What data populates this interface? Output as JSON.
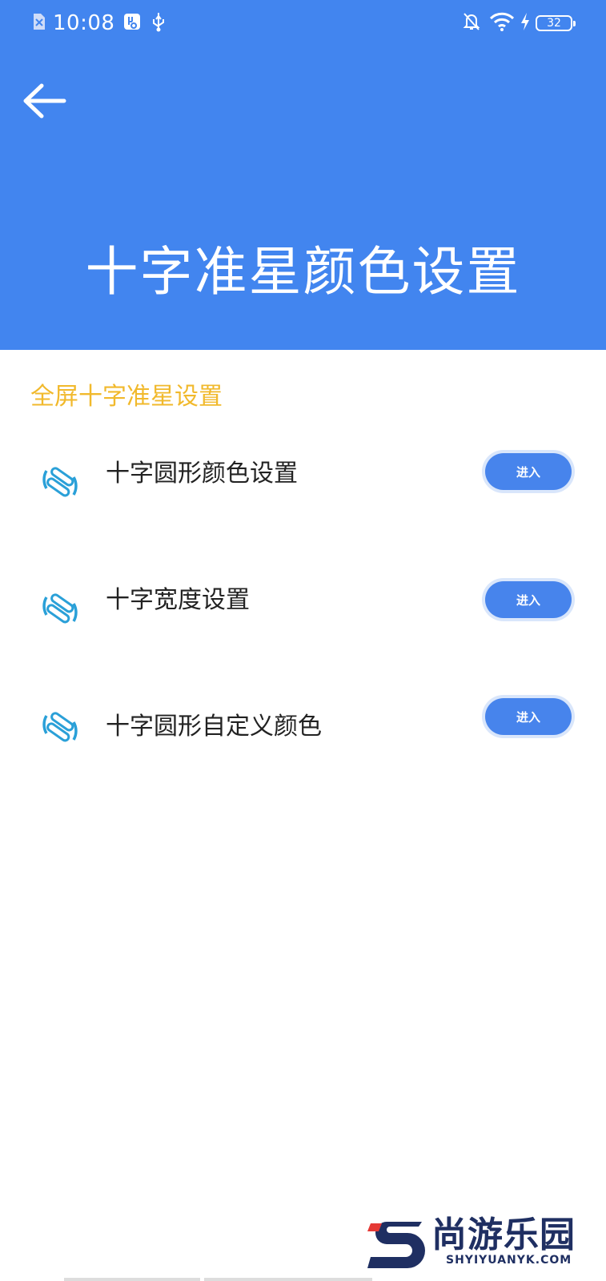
{
  "status_bar": {
    "time": "10:08",
    "battery": "32"
  },
  "header": {
    "title": "十字准星颜色设置"
  },
  "section": {
    "title": "全屏十字准星设置"
  },
  "items": [
    {
      "label": "十字圆形颜色设置",
      "button": "进入"
    },
    {
      "label": "十字宽度设置",
      "button": "进入"
    },
    {
      "label": "十字圆形自定义颜色",
      "button": "进入"
    }
  ],
  "watermark": {
    "brand": "尚游乐园",
    "site": "SHYIYUANYK.COM"
  },
  "colors": {
    "header_bg": "#4285ef",
    "section_title": "#f1b92c",
    "button_bg": "#4784ec",
    "icon": "#2aa0d8"
  }
}
